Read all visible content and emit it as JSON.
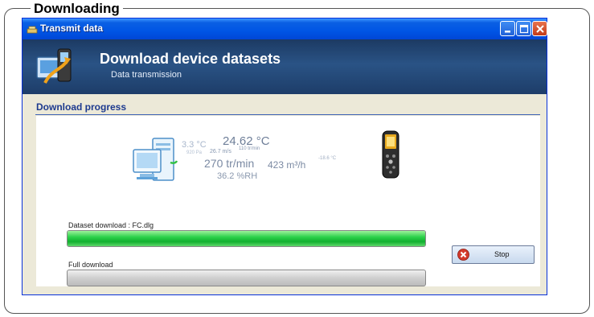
{
  "page": {
    "heading": "Downloading"
  },
  "window": {
    "title": "Transmit data",
    "title_icon": "app-icon",
    "controls": [
      "minimize-icon",
      "maximize-icon",
      "close-icon"
    ]
  },
  "banner": {
    "title": "Download device datasets",
    "subtitle": "Data transmission",
    "icon": "transfer-icon"
  },
  "section": {
    "title": "Download progress"
  },
  "animation": {
    "values": [
      "3.3 °C",
      "24.62 °C",
      "920 Pa",
      "26.7 m/s",
      "110 tr/min",
      "270 tr/min",
      "423 m³/h",
      "-18.6 °C",
      "36.2 %RH"
    ]
  },
  "progress": {
    "dataset": {
      "label": "Dataset download : FC.dlg",
      "value": 1.0
    },
    "full": {
      "label": "Full download",
      "value": 0.0
    }
  },
  "buttons": {
    "stop": "Stop"
  },
  "colors": {
    "title_bar": "#0055e5",
    "banner": "#2a5385",
    "progress_fill": "#2cd14a",
    "section_title": "#1d3a8f"
  }
}
